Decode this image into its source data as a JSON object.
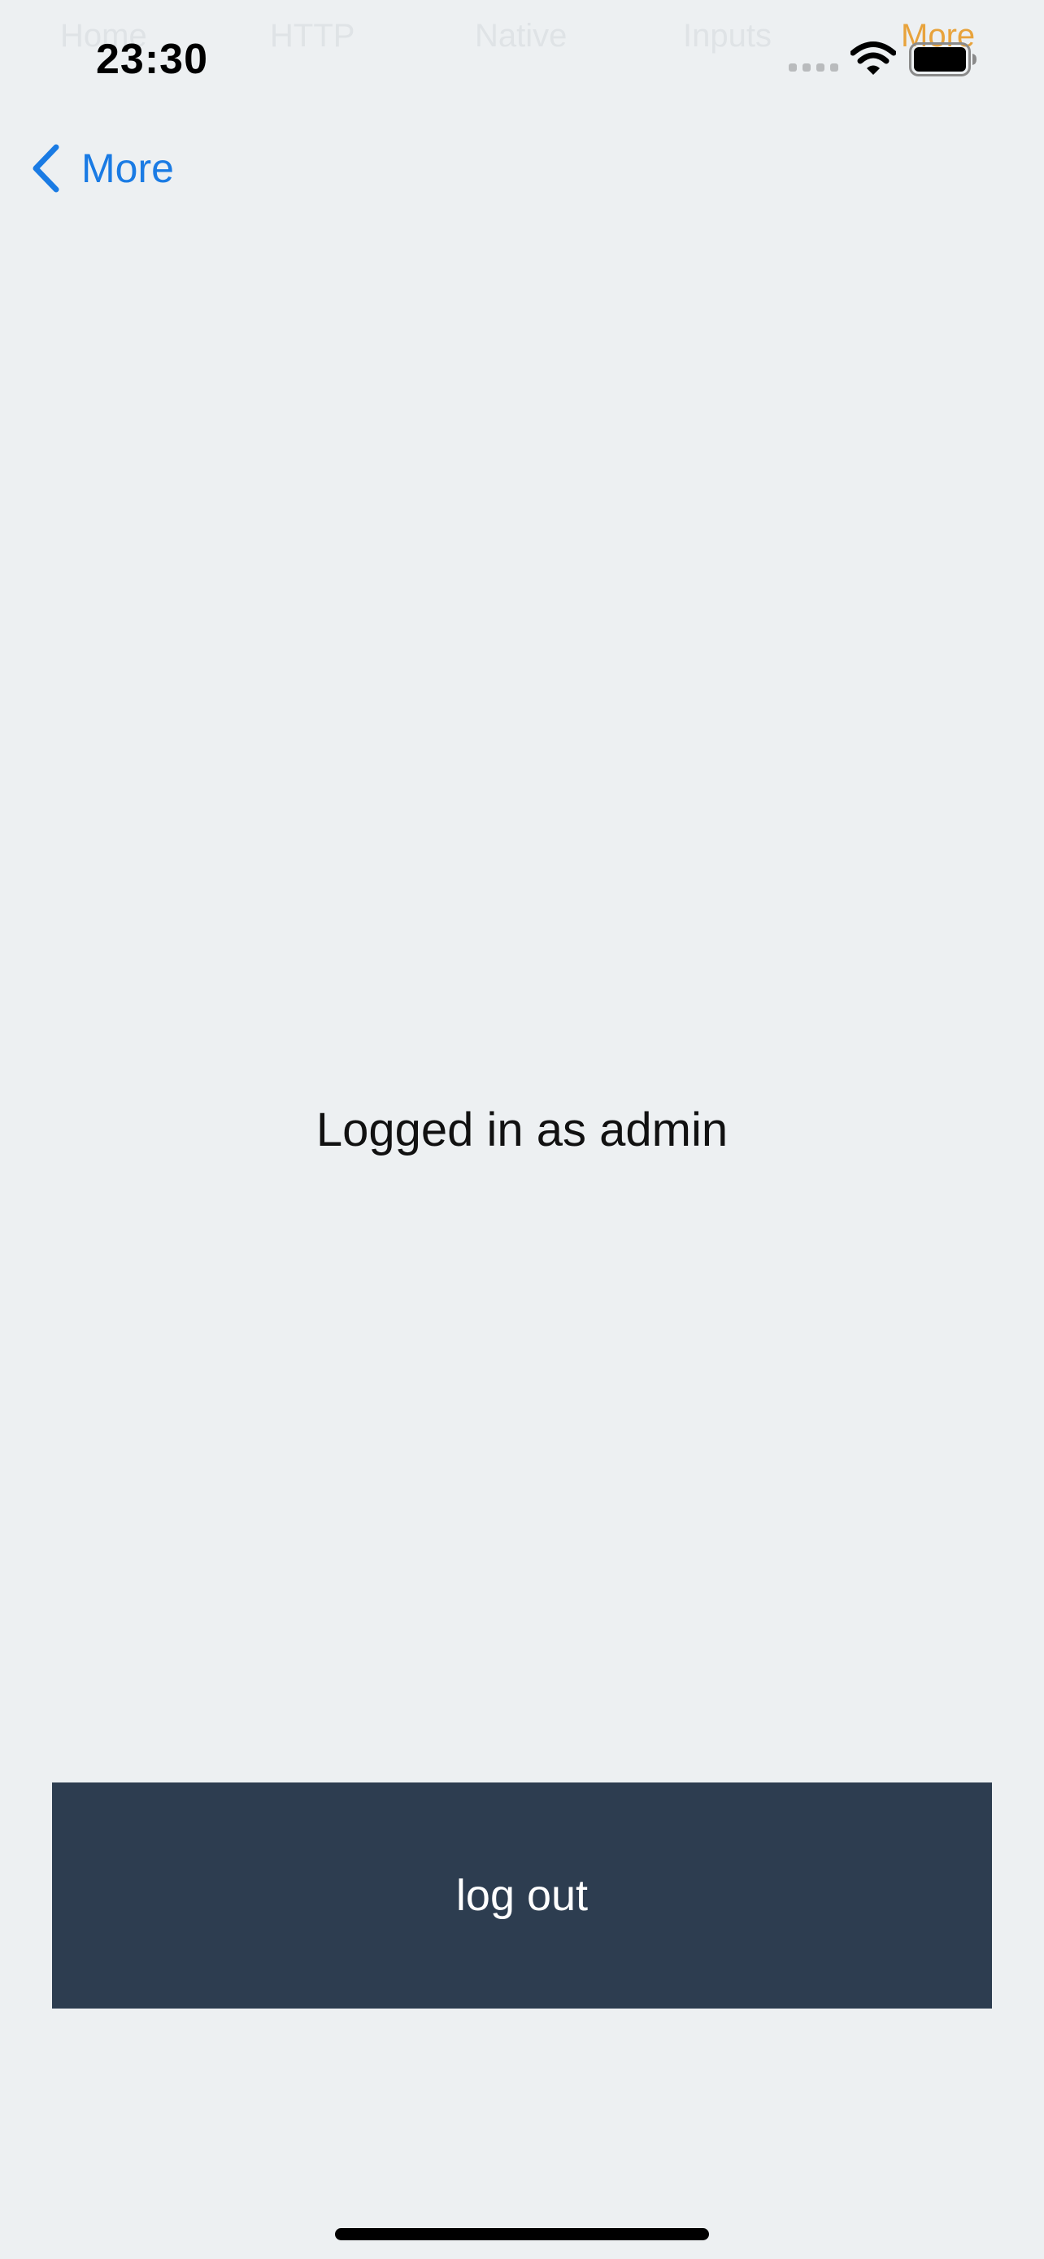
{
  "status_bar": {
    "time": "23:30"
  },
  "ghost_tabs": [
    "Home",
    "HTTP",
    "Native",
    "Inputs",
    "More"
  ],
  "nav": {
    "back_label": "More",
    "back_icon": "chevron-left-icon"
  },
  "main": {
    "login_status": "Logged in as admin"
  },
  "actions": {
    "logout_label": "log out"
  },
  "colors": {
    "background": "#edf0f2",
    "accent": "#1a7be4",
    "active_tab": "#e8a33c",
    "button": "#2d3d50",
    "button_text": "#ffffff"
  }
}
